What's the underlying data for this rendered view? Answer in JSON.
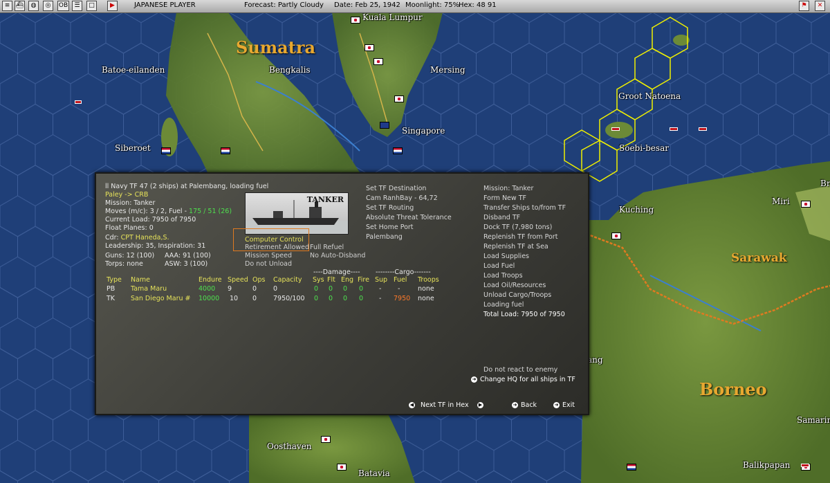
{
  "topbar": {
    "player": "JAPANESE PLAYER",
    "forecast": "Forecast: Partly Cloudy",
    "date": "Date: Feb 25, 1942",
    "moonlight": "Moonlight: 75%",
    "hex": "Hex: 48 91",
    "btn_ob": "OB"
  },
  "map": {
    "labels": {
      "sumatra": "Sumatra",
      "kuala_lumpur": "Kuala Lumpur",
      "batoe": "Batoe-eilanden",
      "bengkalis": "Bengkalis",
      "mersing": "Mersing",
      "groot_natoena": "Groot Natoena",
      "singapore": "Singapore",
      "siberoet": "Siberoet",
      "soebi": "Soebi-besar",
      "kuching": "Kuching",
      "miri": "Miri",
      "br": "Br",
      "sarawak": "Sarawak",
      "borneo": "Borneo",
      "ang": "ang",
      "samarin": "Samarin",
      "oosthaven": "Oosthaven",
      "batavia": "Batavia",
      "balikpapan": "Balikpapan"
    }
  },
  "panel": {
    "header": "ll Navy TF 47 (2 ships) at Palembang, loading fuel",
    "route": "Paley -> CRB",
    "mission": "Mission: Tanker",
    "moves_prefix": "Moves (m/c): 3 / 2, Fuel - ",
    "moves_fuel": "175 / 51 (26)",
    "current_load": "Current Load: 7950 of 7950",
    "float_planes": "Float Planes: 0",
    "ship_photo_label": "TANKER",
    "cdr_prefix": "Cdr: ",
    "cdr_name": "CPT Haneda,S.",
    "leadership": "Leadership: 35, Inspiration: 31",
    "guns": "Guns: 12 (100)",
    "aaa": "AAA: 91 (100)",
    "torps": "Torps: none",
    "asw": "ASW: 3 (100)",
    "computer_control": "Computer Control",
    "retirement": "Retirement Allowed",
    "full_refuel": "Full Refuel",
    "mission_speed": "Mission Speed",
    "no_auto_disband": "No Auto-Disband",
    "do_not_unload": "Do not Unload",
    "damage_header": "----Damage----",
    "cargo_header": "--------Cargo-------",
    "columns": [
      "Type",
      "Name",
      "Endure",
      "Speed",
      "Ops",
      "Capacity",
      "Sys",
      "Flt",
      "Eng",
      "Fire",
      "Sup",
      "Fuel",
      "Troops"
    ],
    "ships": [
      {
        "type": "PB",
        "name": "Tama Maru",
        "endure": "4000",
        "speed": "9",
        "ops": "0",
        "capacity": "0",
        "sys": "0",
        "flt": "0",
        "eng": "0",
        "fire": "0",
        "sup": "-",
        "fuel": "-",
        "troops": "none"
      },
      {
        "type": "TK",
        "name": "San Diego Maru #",
        "endure": "10000",
        "speed": "10",
        "ops": "0",
        "capacity": "7950/100",
        "sys": "0",
        "flt": "0",
        "eng": "0",
        "fire": "0",
        "sup": "-",
        "fuel": "7950",
        "troops": "none"
      }
    ],
    "middle_menu": [
      "Set TF Destination",
      "Cam RanhBay - 64,72",
      "Set TF Routing",
      "Absolute Threat Tolerance",
      "Set Home Port",
      "Palembang"
    ],
    "right_menu": [
      "Mission: Tanker",
      "Form New TF",
      "Transfer Ships to/from TF",
      "Disband TF",
      "Dock TF (7,980 tons)",
      "Replenish TF from Port",
      "Replenish TF at Sea",
      "Load Supplies",
      "Load Fuel",
      "Load Troops",
      "Load Oil/Resources",
      "Unload Cargo/Troops",
      "Loading fuel",
      "Total Load: 7950 of 7950"
    ],
    "do_not_react": "Do not react to enemy",
    "change_hq": "Change HQ for all ships in TF",
    "next_tf": "Next TF in Hex",
    "back": "Back",
    "exit": "Exit"
  },
  "colors": {
    "water": "#1f3f78",
    "land": "#6b8a3a",
    "panel": "#45453f",
    "highlight": "#e6e25a",
    "good": "#4ee04e",
    "warn": "#ff7a2a"
  }
}
